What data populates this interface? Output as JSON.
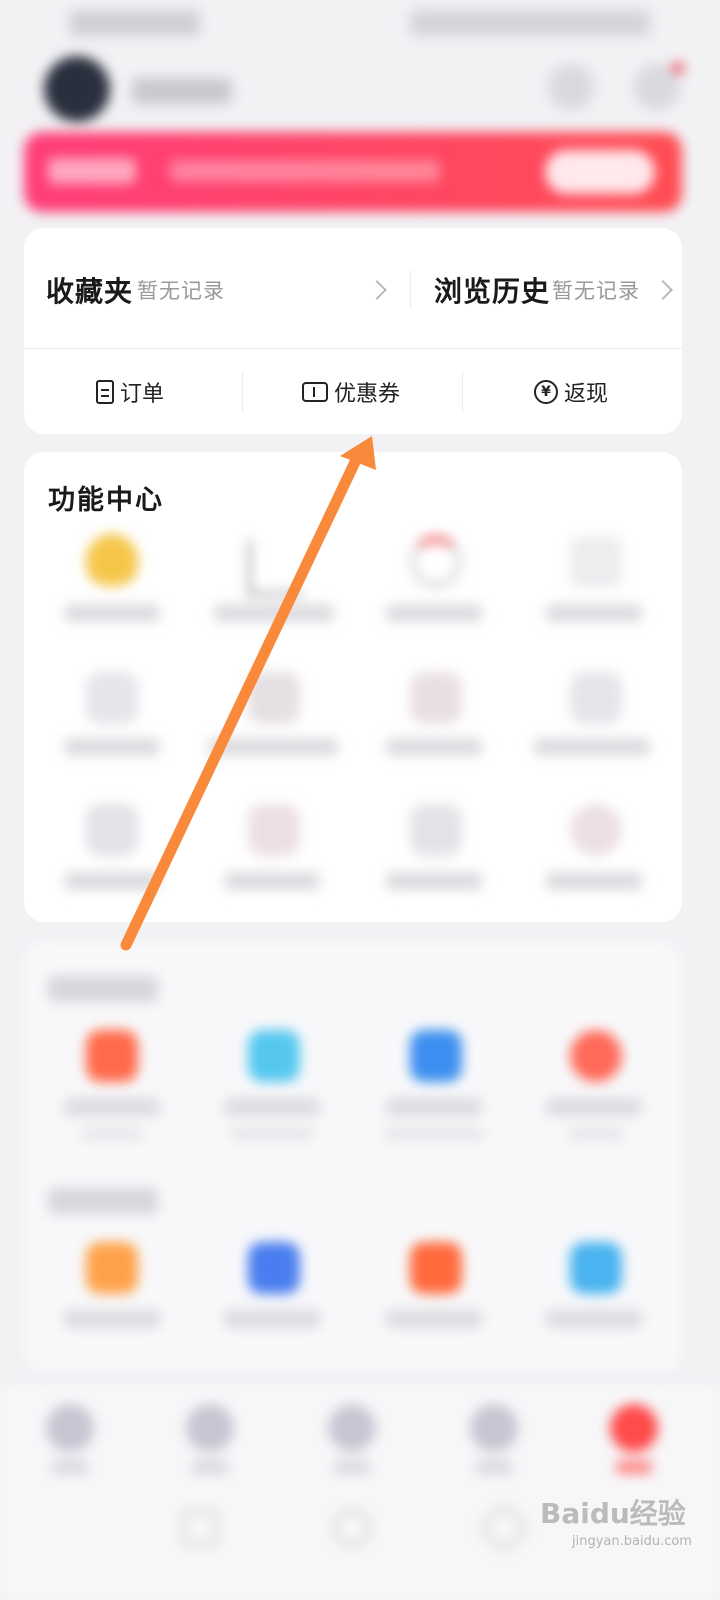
{
  "records": {
    "favorites": {
      "title": "收藏夹",
      "status": "暂无记录"
    },
    "history": {
      "title": "浏览历史",
      "status": "暂无记录"
    }
  },
  "quick_actions": [
    {
      "label": "订单",
      "icon": "order-icon"
    },
    {
      "label": "优惠券",
      "icon": "coupon-icon"
    },
    {
      "label": "返现",
      "icon": "yen-icon"
    }
  ],
  "function_center": {
    "title": "功能中心"
  },
  "watermark": {
    "text": "Baidu经验",
    "sub": "jingyan.baidu.com"
  },
  "colors": {
    "banner_start": "#ff3d78",
    "banner_end": "#ff4c52",
    "annotation_arrow": "#f98a3c"
  }
}
